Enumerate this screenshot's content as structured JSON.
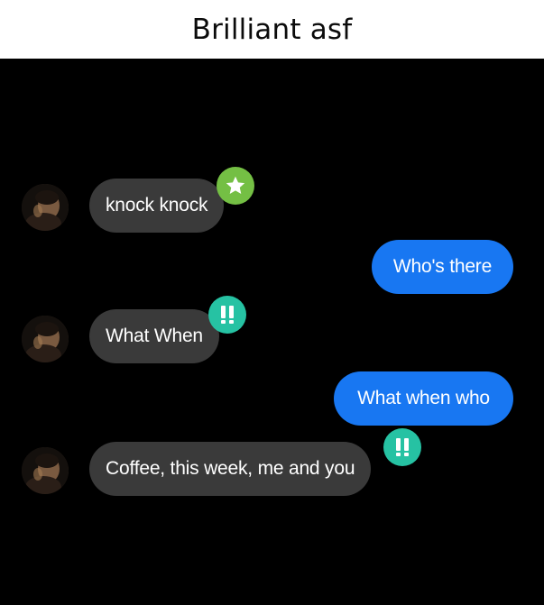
{
  "caption": {
    "title": "Brilliant asf"
  },
  "colors": {
    "incoming_bubble": "#3a3a3a",
    "outgoing_bubble": "#1877f2",
    "chat_background": "#000000",
    "star_badge": "#74bf44",
    "brilliant_badge": "#26c2a3"
  },
  "messages": [
    {
      "side": "incoming",
      "text": "knock knock",
      "badge": "star-icon"
    },
    {
      "side": "outgoing",
      "text": "Who's there"
    },
    {
      "side": "incoming",
      "text": "What When",
      "badge": "double-exclamation-icon"
    },
    {
      "side": "outgoing",
      "text": "What when who"
    },
    {
      "side": "incoming",
      "text": "Coffee, this week, me and you",
      "badge": "double-exclamation-icon"
    }
  ]
}
